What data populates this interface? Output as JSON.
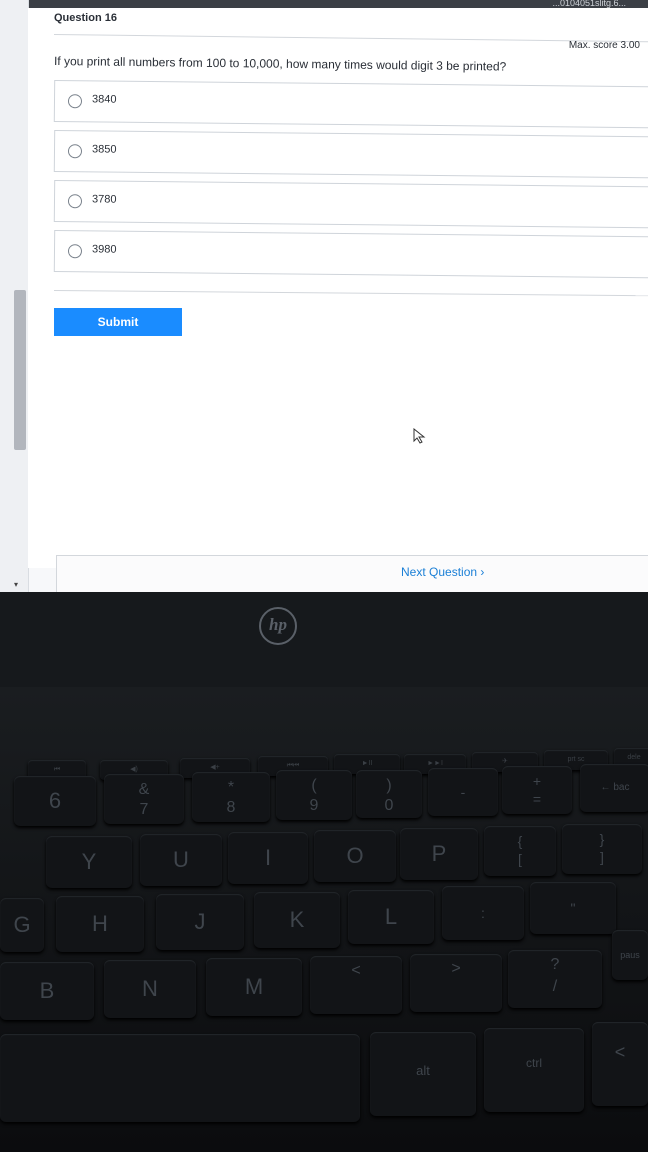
{
  "header": {
    "browser_fragment": "...0104051slitg.6..."
  },
  "question": {
    "title": "Question  16",
    "max_score": "Max. score 3.00",
    "text": "If you print all numbers from 100 to 10,000, how many times would digit 3 be printed?",
    "options": [
      {
        "label": "3840"
      },
      {
        "label": "3850"
      },
      {
        "label": "3780"
      },
      {
        "label": "3980"
      }
    ]
  },
  "actions": {
    "submit_label": "Submit",
    "next_label": "Next Question ›"
  },
  "laptop": {
    "brand": "hp"
  },
  "keyboard": {
    "function_row": [
      "⏮",
      "◀)",
      "◀+",
      "⏮⏮",
      "►II",
      "►►I",
      "✈",
      "prt sc",
      "dele"
    ],
    "number_row": [
      "6",
      "&\n7",
      "*\n8",
      "(\n9",
      ")\n0",
      "-",
      "+\n=",
      "← bac"
    ],
    "upper_row": [
      "Y",
      "U",
      "I",
      "O",
      "P",
      "{\n[",
      "}\n]"
    ],
    "home_row": [
      "G",
      "H",
      "J",
      "K",
      "L",
      ":",
      "\"",
      "paus"
    ],
    "lower_row": [
      "B",
      "N",
      "M",
      "<",
      ">",
      "?\n/"
    ],
    "bottom_row": [
      "alt",
      "ctrl",
      "<"
    ]
  },
  "colors": {
    "accent": "#1a8cff",
    "link": "#1a7fd6"
  }
}
